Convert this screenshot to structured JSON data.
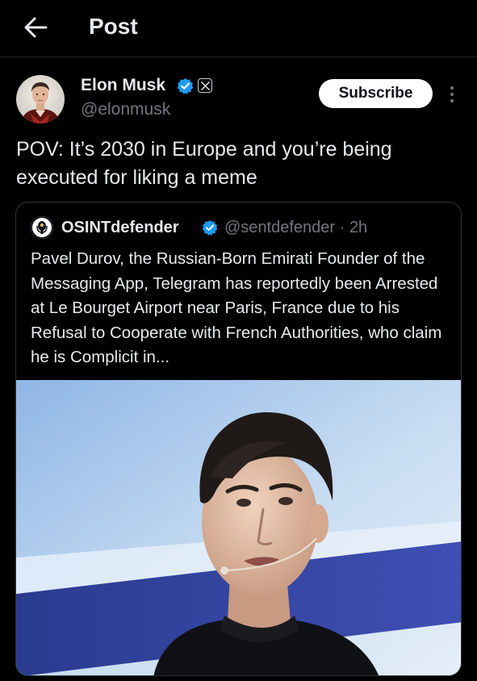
{
  "header": {
    "title": "Post",
    "back_icon": "arrow-left-icon"
  },
  "author": {
    "name": "Elon Musk",
    "handle": "@elonmusk",
    "verified": true,
    "affiliate_badge_icon": "x-logo-icon",
    "subscribe_label": "Subscribe",
    "more_icon": "more-vertical-icon"
  },
  "post": {
    "text": "POV: It’s 2030 in Europe and you’re being executed for liking a meme"
  },
  "quoted": {
    "name": "OSINTdefender",
    "handle": "@sentdefender",
    "time": "2h",
    "verified": true,
    "text": "Pavel Durov, the Russian-Born Emirati Founder of the Messaging App, Telegram has reportedly been Arrested at Le Bourget Airport near Paris, France due to his Refusal to Cooperate with French Authorities, who claim he is Complicit in...",
    "media_icon": "photo-icon"
  },
  "colors": {
    "background": "#000000",
    "text_primary": "#e7e9ea",
    "text_secondary": "#71767b",
    "verified_blue": "#1d9bf0",
    "border": "#2f3336",
    "button_bg": "#ffffff"
  }
}
